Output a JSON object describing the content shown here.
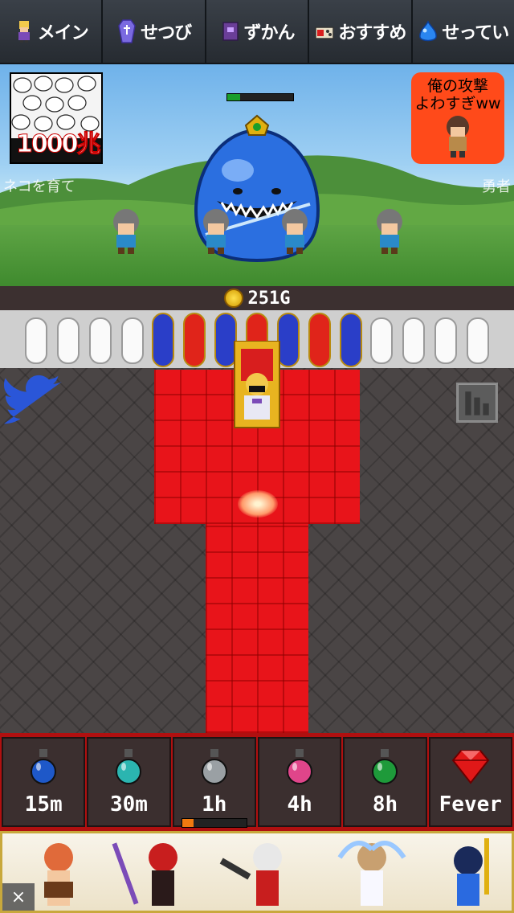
{
  "nav": {
    "tabs": [
      {
        "label": "メイン",
        "icon": "hero-icon"
      },
      {
        "label": "せつび",
        "icon": "coffin-icon"
      },
      {
        "label": "ずかん",
        "icon": "book-icon"
      },
      {
        "label": "おすすめ",
        "icon": "gift-icon"
      },
      {
        "label": "せってい",
        "icon": "slime-icon"
      }
    ]
  },
  "battle": {
    "ad_left": {
      "text": "1000兆"
    },
    "ad_right": {
      "line1": "俺の攻撃",
      "line2": "よわすぎww"
    },
    "boss_hp_fraction": 0.2,
    "scroll_left": "ネコを育て",
    "scroll_right": "勇者"
  },
  "gold": {
    "amount": "251G"
  },
  "items": [
    {
      "label": "15m",
      "color": "#1e58c8",
      "icon": "blue-potion-icon"
    },
    {
      "label": "30m",
      "color": "#2bb5b0",
      "icon": "teal-potion-icon"
    },
    {
      "label": "1h",
      "color": "#9aa0a4",
      "icon": "gray-potion-icon"
    },
    {
      "label": "4h",
      "color": "#e0458a",
      "icon": "pink-potion-icon"
    },
    {
      "label": "8h",
      "color": "#1e9a3a",
      "icon": "green-potion-icon"
    },
    {
      "label": "Fever",
      "color": "#e01818",
      "icon": "red-gem-icon"
    }
  ],
  "cooldown_fraction": 0.18,
  "colors": {
    "carpet": "#e8141a",
    "nav_bg": "#2b3036",
    "accent_gold": "#ffd23a"
  }
}
